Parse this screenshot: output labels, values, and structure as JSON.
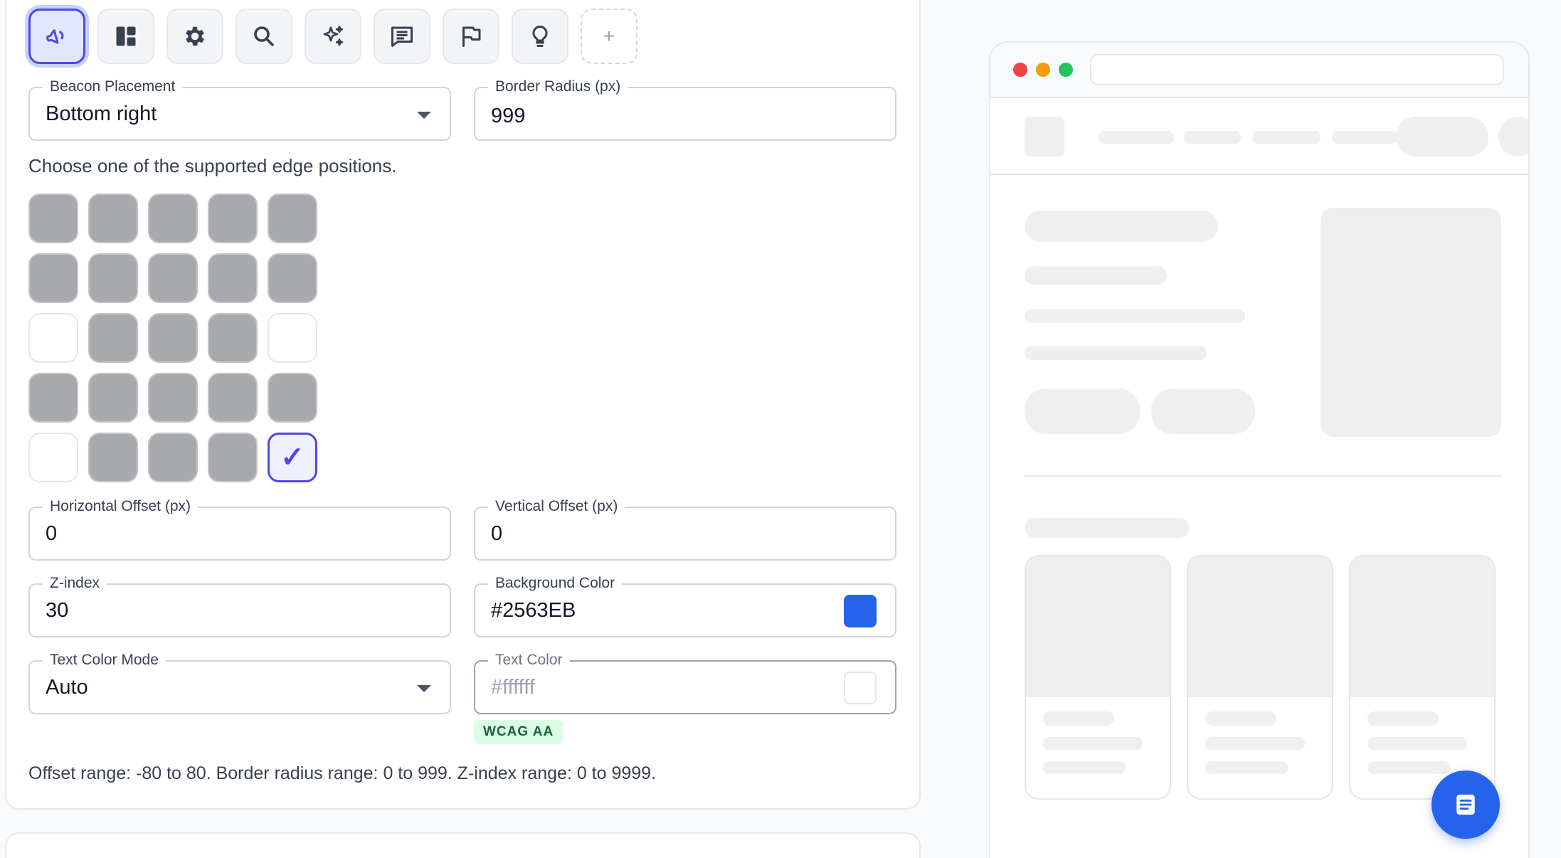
{
  "toolbar": {
    "icons": [
      "megaphone-icon",
      "layout-icon",
      "gear-icon",
      "search-icon",
      "sparkles-icon",
      "message-icon",
      "flag-icon",
      "lightbulb-icon"
    ],
    "add_label": "+"
  },
  "form": {
    "placement_label": "Beacon Placement",
    "placement_value": "Bottom right",
    "radius_label": "Border Radius (px)",
    "radius_value": "999",
    "placement_help": "Choose one of the supported edge positions.",
    "hoffset_label": "Horizontal Offset (px)",
    "hoffset_value": "0",
    "voffset_label": "Vertical Offset (px)",
    "voffset_value": "0",
    "zindex_label": "Z-index",
    "zindex_value": "30",
    "bgcolor_label": "Background Color",
    "bgcolor_value": "#2563EB",
    "textmode_label": "Text Color Mode",
    "textmode_value": "Auto",
    "textcolor_label": "Text Color",
    "textcolor_placeholder": "#ffffff",
    "badge": "WCAG AA",
    "ranges_help": "Offset range: -80 to 80. Border radius range: 0 to 999. Z-index range: 0 to 9999."
  },
  "placement_grid": {
    "rows": [
      [
        "filled",
        "filled",
        "filled",
        "filled",
        "filled"
      ],
      [
        "filled",
        "filled",
        "filled",
        "filled",
        "filled"
      ],
      [
        "empty",
        "filled",
        "filled",
        "filled",
        "empty"
      ],
      [
        "filled",
        "filled",
        "filled",
        "filled",
        "filled"
      ],
      [
        "empty",
        "filled",
        "filled",
        "filled",
        "selected"
      ]
    ],
    "selected_mark": "✓"
  },
  "colors": {
    "accent": "#4f46e5",
    "beacon": "#2563EB",
    "text_swatch": "#ffffff",
    "dot_red": "#ef4444",
    "dot_yellow": "#f59e0b",
    "dot_green": "#22c55e"
  }
}
